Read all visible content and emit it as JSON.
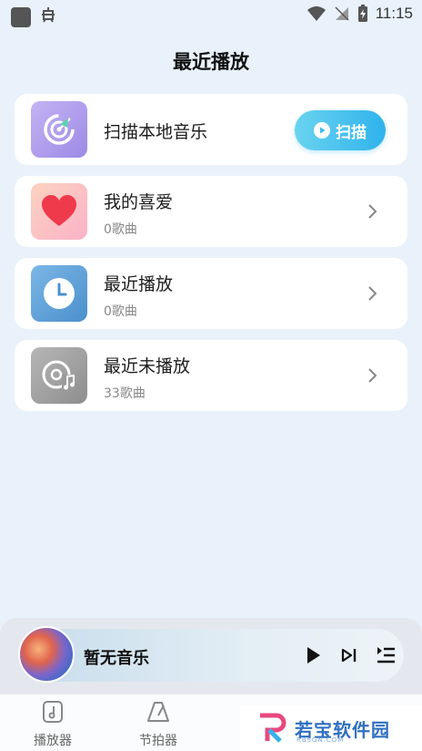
{
  "status_bar": {
    "time": "11:15"
  },
  "page": {
    "title": "最近播放"
  },
  "scan_card": {
    "title": "扫描本地音乐",
    "button_label": "扫描"
  },
  "favorites_card": {
    "title": "我的喜爱",
    "count": "0歌曲"
  },
  "recent_card": {
    "title": "最近播放",
    "count": "0歌曲"
  },
  "unplayed_card": {
    "title": "最近未播放",
    "count": "33歌曲"
  },
  "player": {
    "title": "暂无音乐"
  },
  "tabs": [
    {
      "label": "播放器"
    },
    {
      "label": "节拍器"
    }
  ],
  "watermark": {
    "text": "若宝软件园",
    "sub": "RBSGN.COM"
  },
  "colors": {
    "accent": "#2fb3ec",
    "background": "#e9f2fb",
    "heart": "#ef3a4b",
    "clock_bg": "#4a90cc"
  },
  "icons": {
    "scan": "radar-scan-icon",
    "favorites": "heart-icon",
    "recent": "clock-icon",
    "unplayed": "disc-music-icon"
  }
}
